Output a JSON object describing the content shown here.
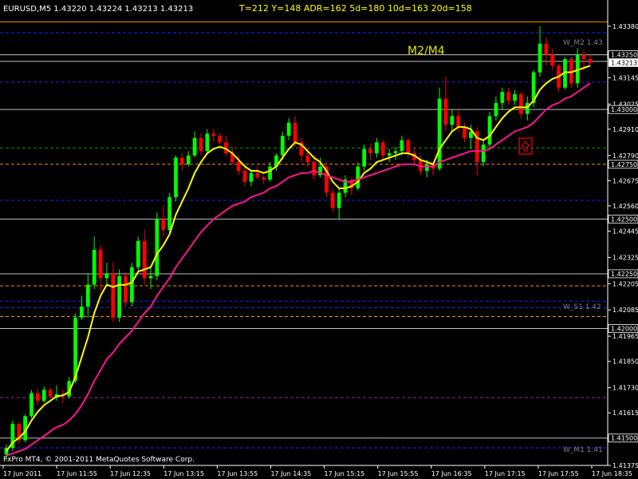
{
  "header": {
    "symbol_line": "EURUSD,M5  1.43220 1.43224 1.43213 1.43213",
    "stats_line": "T=212 Y=148  ADR=162  5d=180  10d=163  20d=158",
    "pair_label": "M2/M4",
    "copyright": "FxPro MT4, © 2001-2011 MetaQuotes Software Corp."
  },
  "colors": {
    "background": "#000000",
    "axis": "#ffffff",
    "bull": "#00ff00",
    "bear": "#ff0000",
    "fast_ma": "#ffff00",
    "slow_ma": "#ff1493",
    "level_line": "#c0c0c0",
    "blue_dash": "#2020ff",
    "orange_dash": "#ff8c00",
    "green_dash": "#00a000",
    "price_marker_bg": "#0000ff"
  },
  "level_labels": {
    "w_m2": "W_M2 1.43",
    "w_s1": "W_S1 1.42",
    "w_m1": "W_M1 1.41"
  },
  "marker_icon": "up-arrow-box-icon",
  "chart_data": {
    "type": "candlestick",
    "title": "EURUSD,M5",
    "ylim": [
      1.41375,
      1.435
    ],
    "y_ticks": [
      "1.43380",
      "1.43250",
      "1.43145",
      "1.43025",
      "1.42910",
      "1.42790",
      "1.42675",
      "1.42560",
      "1.42445",
      "1.42325",
      "1.42205",
      "1.42085",
      "1.41965",
      "1.41850",
      "1.41730",
      "1.41615",
      "1.41495",
      "1.41375"
    ],
    "y_highlight_labels": [
      {
        "value": 1.4325,
        "text": "1.43250",
        "style": "box"
      },
      {
        "value": 1.43213,
        "text": "1.43213",
        "style": "current"
      },
      {
        "value": 1.43,
        "text": "1.43000",
        "style": "box"
      },
      {
        "value": 1.4275,
        "text": "1.42750",
        "style": "box"
      },
      {
        "value": 1.425,
        "text": "1.42500",
        "style": "box"
      },
      {
        "value": 1.4225,
        "text": "1.42250",
        "style": "box"
      },
      {
        "value": 1.42,
        "text": "1.42000",
        "style": "box"
      },
      {
        "value": 1.415,
        "text": "1.41500",
        "style": "box"
      }
    ],
    "x_tick_labels": [
      "17 Jun 2011",
      "17 Jun 11:55",
      "17 Jun 12:35",
      "17 Jun 13:15",
      "17 Jun 13:55",
      "17 Jun 14:35",
      "17 Jun 15:15",
      "17 Jun 15:55",
      "17 Jun 16:35",
      "17 Jun 17:15",
      "17 Jun 17:55",
      "17 Jun 18:35"
    ],
    "horizontal_levels": [
      {
        "value": 1.434,
        "style": "solid",
        "color": "orange"
      },
      {
        "value": 1.4335,
        "style": "dash",
        "color": "blue"
      },
      {
        "value": 1.4325,
        "style": "solid",
        "color": "gray"
      },
      {
        "value": 1.4322,
        "style": "solid",
        "color": "gray"
      },
      {
        "value": 1.43125,
        "style": "dash",
        "color": "blue"
      },
      {
        "value": 1.43,
        "style": "solid",
        "color": "gray"
      },
      {
        "value": 1.42825,
        "style": "dash",
        "color": "green"
      },
      {
        "value": 1.4275,
        "style": "dash",
        "color": "orange"
      },
      {
        "value": 1.42585,
        "style": "dash",
        "color": "blue"
      },
      {
        "value": 1.425,
        "style": "solid",
        "color": "gray"
      },
      {
        "value": 1.4225,
        "style": "solid",
        "color": "gray"
      },
      {
        "value": 1.42195,
        "style": "dash",
        "color": "orange"
      },
      {
        "value": 1.42125,
        "style": "dash",
        "color": "blue"
      },
      {
        "value": 1.42095,
        "style": "dash",
        "color": "blue"
      },
      {
        "value": 1.42055,
        "style": "dash",
        "color": "orange"
      },
      {
        "value": 1.42,
        "style": "solid",
        "color": "gray"
      },
      {
        "value": 1.41685,
        "style": "dash",
        "color": "purple"
      },
      {
        "value": 1.415,
        "style": "solid",
        "color": "gray"
      },
      {
        "value": 1.41455,
        "style": "dash",
        "color": "blue"
      }
    ],
    "candles": [
      {
        "o": 1.41425,
        "h": 1.4147,
        "l": 1.41395,
        "c": 1.41455
      },
      {
        "o": 1.41455,
        "h": 1.4158,
        "l": 1.4144,
        "c": 1.41565
      },
      {
        "o": 1.41565,
        "h": 1.41575,
        "l": 1.4147,
        "c": 1.4149
      },
      {
        "o": 1.4149,
        "h": 1.4161,
        "l": 1.4148,
        "c": 1.416
      },
      {
        "o": 1.416,
        "h": 1.4172,
        "l": 1.4159,
        "c": 1.41705
      },
      {
        "o": 1.41705,
        "h": 1.41725,
        "l": 1.4165,
        "c": 1.4167
      },
      {
        "o": 1.4167,
        "h": 1.41735,
        "l": 1.4166,
        "c": 1.4172
      },
      {
        "o": 1.4172,
        "h": 1.4173,
        "l": 1.4168,
        "c": 1.4169
      },
      {
        "o": 1.4169,
        "h": 1.4174,
        "l": 1.4167,
        "c": 1.417
      },
      {
        "o": 1.417,
        "h": 1.4172,
        "l": 1.4166,
        "c": 1.4169
      },
      {
        "o": 1.4169,
        "h": 1.4178,
        "l": 1.4168,
        "c": 1.4176
      },
      {
        "o": 1.4176,
        "h": 1.4207,
        "l": 1.4175,
        "c": 1.4205
      },
      {
        "o": 1.4205,
        "h": 1.4215,
        "l": 1.4204,
        "c": 1.421
      },
      {
        "o": 1.421,
        "h": 1.4225,
        "l": 1.4205,
        "c": 1.422
      },
      {
        "o": 1.422,
        "h": 1.4242,
        "l": 1.4218,
        "c": 1.4236
      },
      {
        "o": 1.4236,
        "h": 1.4238,
        "l": 1.4217,
        "c": 1.4223
      },
      {
        "o": 1.4223,
        "h": 1.423,
        "l": 1.422,
        "c": 1.4225
      },
      {
        "o": 1.4225,
        "h": 1.423,
        "l": 1.4203,
        "c": 1.4205
      },
      {
        "o": 1.4205,
        "h": 1.4227,
        "l": 1.4203,
        "c": 1.4224
      },
      {
        "o": 1.4224,
        "h": 1.4226,
        "l": 1.421,
        "c": 1.4212
      },
      {
        "o": 1.4212,
        "h": 1.423,
        "l": 1.421,
        "c": 1.4228
      },
      {
        "o": 1.4228,
        "h": 1.4242,
        "l": 1.4226,
        "c": 1.424
      },
      {
        "o": 1.424,
        "h": 1.4245,
        "l": 1.422,
        "c": 1.4223
      },
      {
        "o": 1.4223,
        "h": 1.4229,
        "l": 1.4218,
        "c": 1.4224
      },
      {
        "o": 1.4224,
        "h": 1.4253,
        "l": 1.4222,
        "c": 1.425
      },
      {
        "o": 1.425,
        "h": 1.4256,
        "l": 1.4242,
        "c": 1.4245
      },
      {
        "o": 1.4245,
        "h": 1.4262,
        "l": 1.4243,
        "c": 1.426
      },
      {
        "o": 1.426,
        "h": 1.4279,
        "l": 1.4258,
        "c": 1.4278
      },
      {
        "o": 1.4278,
        "h": 1.428,
        "l": 1.4272,
        "c": 1.4275
      },
      {
        "o": 1.4275,
        "h": 1.4281,
        "l": 1.4274,
        "c": 1.4279
      },
      {
        "o": 1.4279,
        "h": 1.429,
        "l": 1.4278,
        "c": 1.4287
      },
      {
        "o": 1.4287,
        "h": 1.4289,
        "l": 1.4279,
        "c": 1.4281
      },
      {
        "o": 1.4281,
        "h": 1.4291,
        "l": 1.428,
        "c": 1.4289
      },
      {
        "o": 1.4289,
        "h": 1.4291,
        "l": 1.4285,
        "c": 1.4288
      },
      {
        "o": 1.4288,
        "h": 1.4289,
        "l": 1.4284,
        "c": 1.4285
      },
      {
        "o": 1.4285,
        "h": 1.4288,
        "l": 1.4279,
        "c": 1.428
      },
      {
        "o": 1.428,
        "h": 1.4283,
        "l": 1.4275,
        "c": 1.4276
      },
      {
        "o": 1.4276,
        "h": 1.4279,
        "l": 1.427,
        "c": 1.4272
      },
      {
        "o": 1.4272,
        "h": 1.4274,
        "l": 1.4265,
        "c": 1.4267
      },
      {
        "o": 1.4267,
        "h": 1.4272,
        "l": 1.4265,
        "c": 1.4271
      },
      {
        "o": 1.4271,
        "h": 1.4274,
        "l": 1.4268,
        "c": 1.4269
      },
      {
        "o": 1.4269,
        "h": 1.427,
        "l": 1.4266,
        "c": 1.4268
      },
      {
        "o": 1.4268,
        "h": 1.4276,
        "l": 1.4267,
        "c": 1.4274
      },
      {
        "o": 1.4274,
        "h": 1.428,
        "l": 1.4272,
        "c": 1.4279
      },
      {
        "o": 1.4279,
        "h": 1.429,
        "l": 1.4277,
        "c": 1.4288
      },
      {
        "o": 1.4288,
        "h": 1.4296,
        "l": 1.4286,
        "c": 1.4294
      },
      {
        "o": 1.4294,
        "h": 1.4297,
        "l": 1.4283,
        "c": 1.4285
      },
      {
        "o": 1.4285,
        "h": 1.4287,
        "l": 1.4276,
        "c": 1.4279
      },
      {
        "o": 1.4279,
        "h": 1.4282,
        "l": 1.4274,
        "c": 1.4276
      },
      {
        "o": 1.4276,
        "h": 1.4279,
        "l": 1.4268,
        "c": 1.427
      },
      {
        "o": 1.427,
        "h": 1.4278,
        "l": 1.4269,
        "c": 1.4274
      },
      {
        "o": 1.4274,
        "h": 1.4276,
        "l": 1.426,
        "c": 1.4262
      },
      {
        "o": 1.4262,
        "h": 1.4264,
        "l": 1.4253,
        "c": 1.4255
      },
      {
        "o": 1.4255,
        "h": 1.4264,
        "l": 1.425,
        "c": 1.4262
      },
      {
        "o": 1.4262,
        "h": 1.427,
        "l": 1.426,
        "c": 1.4268
      },
      {
        "o": 1.4268,
        "h": 1.4269,
        "l": 1.4261,
        "c": 1.4264
      },
      {
        "o": 1.4264,
        "h": 1.4276,
        "l": 1.4263,
        "c": 1.4274
      },
      {
        "o": 1.4274,
        "h": 1.4284,
        "l": 1.4272,
        "c": 1.4282
      },
      {
        "o": 1.4282,
        "h": 1.4284,
        "l": 1.4277,
        "c": 1.428
      },
      {
        "o": 1.428,
        "h": 1.4287,
        "l": 1.4278,
        "c": 1.4285
      },
      {
        "o": 1.4285,
        "h": 1.4286,
        "l": 1.4277,
        "c": 1.4279
      },
      {
        "o": 1.4279,
        "h": 1.4282,
        "l": 1.4276,
        "c": 1.428
      },
      {
        "o": 1.428,
        "h": 1.4283,
        "l": 1.4277,
        "c": 1.4281
      },
      {
        "o": 1.4281,
        "h": 1.4288,
        "l": 1.4279,
        "c": 1.4286
      },
      {
        "o": 1.4286,
        "h": 1.4287,
        "l": 1.4278,
        "c": 1.428
      },
      {
        "o": 1.428,
        "h": 1.4283,
        "l": 1.4275,
        "c": 1.4277
      },
      {
        "o": 1.4277,
        "h": 1.4279,
        "l": 1.427,
        "c": 1.4272
      },
      {
        "o": 1.4272,
        "h": 1.4277,
        "l": 1.4269,
        "c": 1.4275
      },
      {
        "o": 1.4275,
        "h": 1.4276,
        "l": 1.427,
        "c": 1.4273
      },
      {
        "o": 1.4273,
        "h": 1.431,
        "l": 1.4272,
        "c": 1.4305
      },
      {
        "o": 1.4305,
        "h": 1.4315,
        "l": 1.429,
        "c": 1.4293
      },
      {
        "o": 1.4293,
        "h": 1.43,
        "l": 1.429,
        "c": 1.4297
      },
      {
        "o": 1.4297,
        "h": 1.43,
        "l": 1.429,
        "c": 1.4292
      },
      {
        "o": 1.4292,
        "h": 1.4294,
        "l": 1.4285,
        "c": 1.4287
      },
      {
        "o": 1.4287,
        "h": 1.4293,
        "l": 1.4282,
        "c": 1.429
      },
      {
        "o": 1.429,
        "h": 1.4292,
        "l": 1.427,
        "c": 1.4276
      },
      {
        "o": 1.4276,
        "h": 1.4286,
        "l": 1.4274,
        "c": 1.4284
      },
      {
        "o": 1.4284,
        "h": 1.4299,
        "l": 1.4282,
        "c": 1.4297
      },
      {
        "o": 1.4297,
        "h": 1.4306,
        "l": 1.4295,
        "c": 1.4303
      },
      {
        "o": 1.4303,
        "h": 1.431,
        "l": 1.43,
        "c": 1.4308
      },
      {
        "o": 1.4308,
        "h": 1.431,
        "l": 1.4302,
        "c": 1.4304
      },
      {
        "o": 1.4304,
        "h": 1.4309,
        "l": 1.4302,
        "c": 1.4307
      },
      {
        "o": 1.4307,
        "h": 1.4308,
        "l": 1.4296,
        "c": 1.4298
      },
      {
        "o": 1.4298,
        "h": 1.4306,
        "l": 1.4295,
        "c": 1.4303
      },
      {
        "o": 1.4303,
        "h": 1.4318,
        "l": 1.4301,
        "c": 1.4317
      },
      {
        "o": 1.4317,
        "h": 1.4338,
        "l": 1.4315,
        "c": 1.433
      },
      {
        "o": 1.433,
        "h": 1.4333,
        "l": 1.432,
        "c": 1.4325
      },
      {
        "o": 1.4325,
        "h": 1.4328,
        "l": 1.4318,
        "c": 1.432
      },
      {
        "o": 1.432,
        "h": 1.4321,
        "l": 1.4308,
        "c": 1.431
      },
      {
        "o": 1.431,
        "h": 1.4324,
        "l": 1.4309,
        "c": 1.4323
      },
      {
        "o": 1.4323,
        "h": 1.4324,
        "l": 1.431,
        "c": 1.4312
      },
      {
        "o": 1.4312,
        "h": 1.4328,
        "l": 1.431,
        "c": 1.4325
      },
      {
        "o": 1.4325,
        "h": 1.4327,
        "l": 1.4318,
        "c": 1.4323
      },
      {
        "o": 1.4323,
        "h": 1.4325,
        "l": 1.432,
        "c": 1.43213
      }
    ],
    "series": [
      {
        "name": "fast_ma",
        "color": "yellow",
        "values": [
          1.4144,
          1.4148,
          1.415,
          1.4153,
          1.4158,
          1.4162,
          1.4165,
          1.4167,
          1.4169,
          1.41695,
          1.4171,
          1.4178,
          1.4187,
          1.4196,
          1.4207,
          1.4215,
          1.422,
          1.4219,
          1.422,
          1.422,
          1.4221,
          1.4226,
          1.4227,
          1.4228,
          1.4234,
          1.4238,
          1.4243,
          1.4252,
          1.4258,
          1.4264,
          1.4271,
          1.4276,
          1.428,
          1.4282,
          1.4283,
          1.4282,
          1.428,
          1.4277,
          1.4274,
          1.4272,
          1.4272,
          1.4271,
          1.4272,
          1.4274,
          1.4278,
          1.4282,
          1.4285,
          1.4284,
          1.4281,
          1.4278,
          1.4276,
          1.4272,
          1.4267,
          1.4264,
          1.4264,
          1.4265,
          1.4267,
          1.4271,
          1.4273,
          1.4276,
          1.4277,
          1.4278,
          1.4279,
          1.428,
          1.428,
          1.4279,
          1.4277,
          1.4276,
          1.4275,
          1.4282,
          1.4286,
          1.429,
          1.4292,
          1.4292,
          1.4291,
          1.4287,
          1.4286,
          1.4288,
          1.4292,
          1.4296,
          1.4299,
          1.4301,
          1.4301,
          1.4301,
          1.4304,
          1.4309,
          1.4312,
          1.4314,
          1.4315,
          1.4317,
          1.4317,
          1.4318,
          1.4319,
          1.432
        ]
      },
      {
        "name": "slow_ma",
        "color": "deeppink",
        "values": [
          1.4142,
          1.4143,
          1.4144,
          1.4145,
          1.4147,
          1.4149,
          1.4151,
          1.4153,
          1.4155,
          1.4156,
          1.4158,
          1.4161,
          1.4165,
          1.417,
          1.4176,
          1.4181,
          1.4186,
          1.4189,
          1.4193,
          1.4196,
          1.4199,
          1.4203,
          1.4207,
          1.421,
          1.4215,
          1.4219,
          1.4223,
          1.4228,
          1.4232,
          1.4236,
          1.424,
          1.4244,
          1.4247,
          1.425,
          1.4252,
          1.4254,
          1.4256,
          1.4257,
          1.4258,
          1.426,
          1.4261,
          1.4262,
          1.4264,
          1.4265,
          1.4267,
          1.4269,
          1.427,
          1.4271,
          1.4271,
          1.4272,
          1.4271,
          1.427,
          1.4269,
          1.4268,
          1.4267,
          1.4267,
          1.4268,
          1.4269,
          1.427,
          1.4271,
          1.4272,
          1.4273,
          1.4274,
          1.4275,
          1.4275,
          1.4275,
          1.4274,
          1.4274,
          1.4274,
          1.4276,
          1.4277,
          1.4278,
          1.4279,
          1.428,
          1.4281,
          1.4281,
          1.4281,
          1.4282,
          1.4284,
          1.4286,
          1.4288,
          1.429,
          1.4291,
          1.4292,
          1.4294,
          1.4297,
          1.43,
          1.4302,
          1.4303,
          1.4305,
          1.4306,
          1.4308,
          1.431,
          1.4312
        ]
      }
    ],
    "grid": false,
    "legend": "none"
  }
}
